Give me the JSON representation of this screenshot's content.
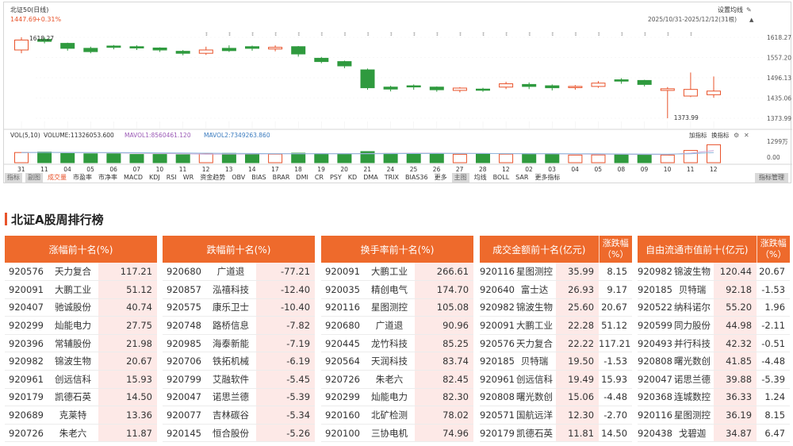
{
  "chart": {
    "title": "北证50(日线)",
    "price": "1447.69",
    "change": "+0.31%",
    "settings_label": "设置均线",
    "range_label": "2025/10/31-2025/12/12(31根)",
    "high_label": "1618.27",
    "low_label": "1373.99",
    "y_ticks": [
      "1618.27",
      "1557.20",
      "1496.13",
      "1435.06",
      "1373.99"
    ],
    "vol_ticks": [
      "1299万",
      "0.00"
    ],
    "vol_info": {
      "vol": "VOL(5,10)",
      "volume": "VOLUME:11326053.600",
      "mavol1": "MAVOL1:8560461.120",
      "mavol2": "MAVOL2:7349263.860"
    },
    "vol_links": [
      "加指标",
      "换指标"
    ],
    "x_labels": [
      "31",
      "11",
      "04",
      "05",
      "06",
      "07",
      "10",
      "11",
      "12",
      "13",
      "14",
      "17",
      "18",
      "19",
      "20",
      "21",
      "24",
      "25",
      "26",
      "27",
      "28",
      "12",
      "02",
      "03",
      "04",
      "05",
      "08",
      "09",
      "10",
      "11",
      "12"
    ],
    "colors": {
      "up": "#e8532b",
      "down": "#2f9a3e",
      "ma1": "#c9a6d6",
      "ma2": "#8fb8dc"
    }
  },
  "chart_data": {
    "type": "candlestick",
    "title": "北证50(日线)",
    "x": [
      "10/31",
      "11/03",
      "11/04",
      "11/05",
      "11/06",
      "11/07",
      "11/10",
      "11/11",
      "11/12",
      "11/13",
      "11/14",
      "11/17",
      "11/18",
      "11/19",
      "11/20",
      "11/21",
      "11/24",
      "11/25",
      "11/26",
      "11/27",
      "11/28",
      "12/01",
      "12/02",
      "12/03",
      "12/04",
      "12/05",
      "12/08",
      "12/09",
      "12/10",
      "12/11",
      "12/12"
    ],
    "open": [
      1580,
      1612,
      1600,
      1585,
      1592,
      1590,
      1586,
      1576,
      1570,
      1585,
      1590,
      1583,
      1590,
      1555,
      1545,
      1520,
      1468,
      1472,
      1468,
      1458,
      1462,
      1468,
      1476,
      1472,
      1468,
      1470,
      1490,
      1488,
      1458,
      1441,
      1445
    ],
    "close": [
      1610,
      1606,
      1585,
      1575,
      1588,
      1586,
      1580,
      1570,
      1580,
      1578,
      1585,
      1588,
      1568,
      1545,
      1532,
      1466,
      1462,
      1470,
      1460,
      1465,
      1460,
      1478,
      1470,
      1466,
      1470,
      1480,
      1486,
      1476,
      1463,
      1461,
      1456
    ],
    "high": [
      1618.27,
      1618,
      1602,
      1590,
      1595,
      1594,
      1588,
      1580,
      1590,
      1594,
      1593,
      1594,
      1592,
      1559,
      1548,
      1524,
      1472,
      1476,
      1470,
      1468,
      1466,
      1484,
      1482,
      1476,
      1474,
      1486,
      1495,
      1490,
      1468,
      1512,
      1500
    ],
    "low": [
      1570,
      1600,
      1578,
      1570,
      1582,
      1580,
      1574,
      1564,
      1565,
      1574,
      1578,
      1576,
      1560,
      1540,
      1525,
      1460,
      1455,
      1460,
      1454,
      1452,
      1454,
      1462,
      1462,
      1458,
      1460,
      1466,
      1478,
      1470,
      1373.99,
      1438,
      1436
    ],
    "volume": [
      640,
      670,
      580,
      560,
      560,
      520,
      520,
      500,
      560,
      590,
      530,
      540,
      600,
      570,
      540,
      700,
      580,
      560,
      560,
      530,
      560,
      540,
      560,
      520,
      480,
      490,
      540,
      500,
      480,
      770,
      1130
    ],
    "ma_vol1": [
      640,
      650,
      640,
      630,
      620,
      600,
      580,
      560,
      540,
      545,
      550,
      560,
      570,
      575,
      570,
      580,
      590,
      600,
      600,
      590,
      580,
      570,
      560,
      560,
      550,
      540,
      530,
      520,
      520,
      600,
      760
    ],
    "ma_vol2": [
      640,
      645,
      645,
      640,
      635,
      630,
      620,
      610,
      600,
      590,
      580,
      570,
      565,
      560,
      560,
      565,
      570,
      575,
      580,
      580,
      580,
      575,
      570,
      570,
      565,
      560,
      550,
      545,
      540,
      560,
      640
    ]
  },
  "indicators": {
    "tag1": "指标",
    "tag2": "副图",
    "items1": [
      "成交量",
      "市盈率",
      "市净率",
      "MACD",
      "KDJ",
      "RSI",
      "WR",
      "资金趋势",
      "OBV",
      "BIAS",
      "BRAR",
      "DMI",
      "CR",
      "PSY",
      "KD",
      "DMA",
      "TRIX",
      "BIAS36",
      "更多"
    ],
    "tag3": "主图",
    "items2": [
      "均线",
      "BOLL",
      "SAR",
      "更多指标"
    ],
    "manage": "指标管理"
  },
  "section_title": "北证A股周排行榜",
  "tables": [
    {
      "header": "涨幅前十名(%)",
      "rows": [
        [
          "920576",
          "天力复合",
          "117.21"
        ],
        [
          "920091",
          "大鹏工业",
          "51.12"
        ],
        [
          "920407",
          "驰诚股份",
          "40.74"
        ],
        [
          "920299",
          "灿能电力",
          "27.75"
        ],
        [
          "920396",
          "常辅股份",
          "21.98"
        ],
        [
          "920982",
          "锦波生物",
          "20.67"
        ],
        [
          "920961",
          "创远信科",
          "15.93"
        ],
        [
          "920179",
          "凯德石英",
          "14.50"
        ],
        [
          "920689",
          "克莱特",
          "13.36"
        ],
        [
          "920726",
          "朱老六",
          "11.87"
        ]
      ]
    },
    {
      "header": "跌幅前十名(%)",
      "rows": [
        [
          "920680",
          "广道退",
          "-77.21"
        ],
        [
          "920857",
          "泓禧科技",
          "-12.40"
        ],
        [
          "920575",
          "康乐卫士",
          "-10.40"
        ],
        [
          "920748",
          "路桥信息",
          "-7.82"
        ],
        [
          "920985",
          "海泰新能",
          "-7.19"
        ],
        [
          "920706",
          "铁拓机械",
          "-6.19"
        ],
        [
          "920799",
          "艾融软件",
          "-5.45"
        ],
        [
          "920047",
          "诺思兰德",
          "-5.39"
        ],
        [
          "920077",
          "吉林碳谷",
          "-5.34"
        ],
        [
          "920145",
          "恒合股份",
          "-5.26"
        ]
      ]
    },
    {
      "header": "换手率前十名(%)",
      "rows": [
        [
          "920091",
          "大鹏工业",
          "266.61"
        ],
        [
          "920035",
          "精创电气",
          "174.70"
        ],
        [
          "920116",
          "星图测控",
          "105.08"
        ],
        [
          "920680",
          "广道退",
          "90.96"
        ],
        [
          "920445",
          "龙竹科技",
          "85.25"
        ],
        [
          "920564",
          "天润科技",
          "83.74"
        ],
        [
          "920726",
          "朱老六",
          "82.45"
        ],
        [
          "920299",
          "灿能电力",
          "82.30"
        ],
        [
          "920160",
          "北矿检测",
          "78.02"
        ],
        [
          "920100",
          "三协电机",
          "74.96"
        ]
      ]
    },
    {
      "header": "成交金额前十名(亿元)",
      "sub_header": "涨跌幅（%）",
      "rows": [
        [
          "920116",
          "星图测控",
          "35.99",
          "8.15"
        ],
        [
          "920640",
          "富士达",
          "26.93",
          "9.17"
        ],
        [
          "920982",
          "锦波生物",
          "25.60",
          "20.67"
        ],
        [
          "920091",
          "大鹏工业",
          "22.28",
          "51.12"
        ],
        [
          "920576",
          "天力复合",
          "22.22",
          "117.21"
        ],
        [
          "920185",
          "贝特瑞",
          "19.50",
          "-1.53"
        ],
        [
          "920961",
          "创远信科",
          "19.49",
          "15.93"
        ],
        [
          "920808",
          "曙光数创",
          "15.06",
          "-4.48"
        ],
        [
          "920571",
          "国航远洋",
          "12.30",
          "-2.70"
        ],
        [
          "920179",
          "凯德石英",
          "11.81",
          "14.50"
        ]
      ]
    },
    {
      "header": "自由流通市值前十(亿元)",
      "sub_header": "涨跌幅（%）",
      "rows": [
        [
          "920982",
          "锦波生物",
          "120.44",
          "20.67"
        ],
        [
          "920185",
          "贝特瑞",
          "92.18",
          "-1.53"
        ],
        [
          "920522",
          "纳科诺尔",
          "55.20",
          "1.96"
        ],
        [
          "920599",
          "同力股份",
          "44.98",
          "-2.11"
        ],
        [
          "920493",
          "并行科技",
          "42.32",
          "-0.51"
        ],
        [
          "920808",
          "曙光数创",
          "41.85",
          "-4.48"
        ],
        [
          "920047",
          "诺思兰德",
          "39.88",
          "-5.39"
        ],
        [
          "920368",
          "连城数控",
          "36.33",
          "1.24"
        ],
        [
          "920116",
          "星图测控",
          "36.19",
          "8.15"
        ],
        [
          "920438",
          "戈碧迦",
          "34.87",
          "6.47"
        ]
      ]
    }
  ]
}
